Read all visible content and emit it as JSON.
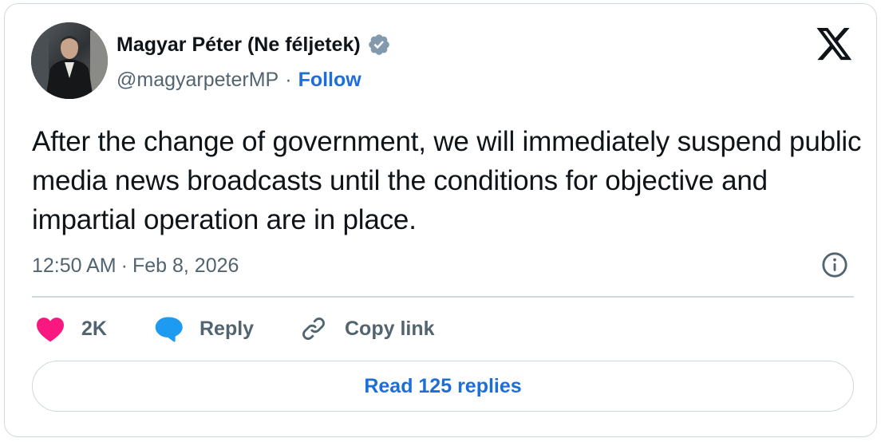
{
  "author": {
    "display_name": "Magyar Péter (Ne féljetek)",
    "handle": "@magyarpeterMP",
    "separator": "·",
    "follow_label": "Follow",
    "verified": true,
    "verified_color": "#829aab"
  },
  "tweet": {
    "text": "After the change of government, we will immediately suspend public media news broadcasts until the conditions for objective and impartial operation are in place.",
    "time": "12:50 AM",
    "separator": "·",
    "date": "Feb 8, 2026"
  },
  "actions": {
    "like_count": "2K",
    "reply_label": "Reply",
    "copy_link_label": "Copy link"
  },
  "read_replies_label": "Read 125 replies",
  "icons": {
    "logo": "x-logo-icon",
    "info": "info-icon",
    "like": "heart-icon",
    "reply": "speech-bubble-icon",
    "copy": "link-icon",
    "verified": "verified-badge-icon"
  },
  "colors": {
    "like": "#f91880",
    "reply": "#1d9bf0",
    "link_blue": "#1d6ed8",
    "muted": "#536471",
    "border": "#cfd9de"
  }
}
